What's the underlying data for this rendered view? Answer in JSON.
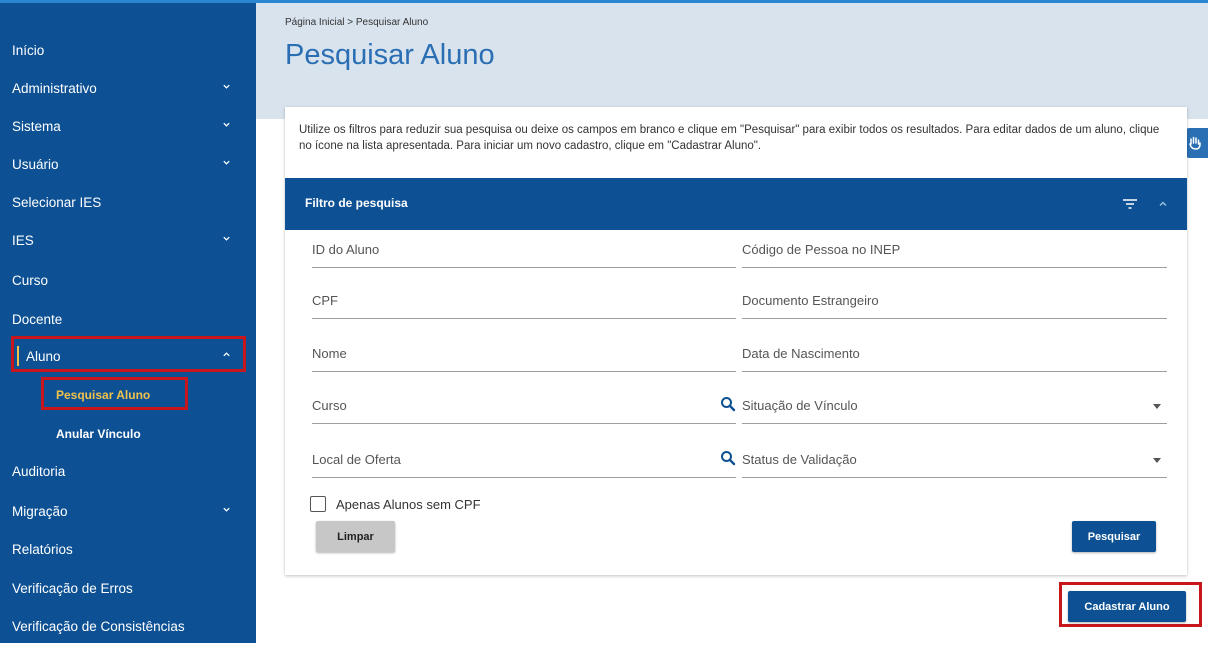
{
  "sidebar": {
    "items": [
      {
        "label": "Início"
      },
      {
        "label": "Administrativo"
      },
      {
        "label": "Sistema"
      },
      {
        "label": "Usuário"
      },
      {
        "label": "Selecionar IES"
      },
      {
        "label": "IES"
      },
      {
        "label": "Curso"
      },
      {
        "label": "Docente"
      },
      {
        "label": "Aluno"
      },
      {
        "label": "Pesquisar Aluno"
      },
      {
        "label": "Anular Vínculo"
      },
      {
        "label": "Auditoria"
      },
      {
        "label": "Migração"
      },
      {
        "label": "Relatórios"
      },
      {
        "label": "Verificação de Erros"
      },
      {
        "label": "Verificação de Consistências"
      }
    ]
  },
  "header": {
    "breadcrumb": "Página Inicial > Pesquisar Aluno",
    "title": "Pesquisar Aluno"
  },
  "main": {
    "intro": "Utilize os filtros para reduzir sua pesquisa ou deixe os campos em branco e clique em \"Pesquisar\" para exibir todos os resultados. Para editar dados de um aluno, clique no ícone na lista apresentada. Para iniciar um novo cadastro, clique em \"Cadastrar Aluno\".",
    "filter_title": "Filtro de pesquisa",
    "fields": {
      "id_aluno": "ID do Aluno",
      "codigo_inep": "Código de Pessoa no INEP",
      "cpf": "CPF",
      "documento_estrangeiro": "Documento Estrangeiro",
      "nome": "Nome",
      "data_nascimento": "Data de Nascimento",
      "curso": "Curso",
      "situacao_vinculo": "Situação de Vínculo",
      "local_oferta": "Local de Oferta",
      "status_validacao": "Status de Validação"
    },
    "checkbox_label": "Apenas Alunos sem CPF",
    "btn_limpar": "Limpar",
    "btn_pesquisar": "Pesquisar",
    "btn_cadastrar": "Cadastrar Aluno"
  },
  "colors": {
    "sidebar_bg": "#0d5194",
    "header_bg": "#d8e3ee",
    "title_color": "#2a6fb3",
    "highlight_red": "#c8161d",
    "active_yellow": "#f2c14a"
  }
}
